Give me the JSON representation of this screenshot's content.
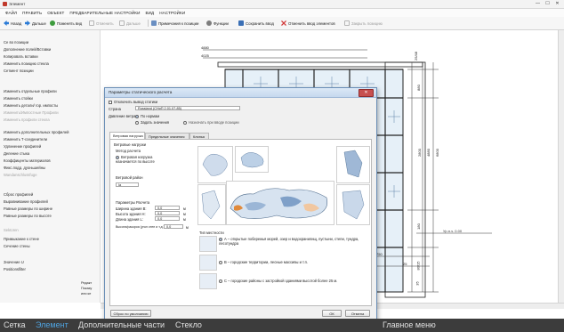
{
  "window": {
    "title": "Элемент",
    "min": "—",
    "max": "☐",
    "close": "✕"
  },
  "menu": [
    "ФАЙЛ",
    "ПРАВИТЬ",
    "ОБЪЕКТ",
    "ПРЕДВАРИТЕЛЬНЫЕ НАСТРОЙКИ",
    "ВИД",
    "НАСТРОЙКИ"
  ],
  "toolbar": {
    "back": "Назад",
    "forward": "Дальше",
    "change_view": "Поменять вид",
    "undo": "Отменить",
    "redo": "Дальше",
    "position_notes": "Примечания к позиции",
    "functions": "Функции",
    "save_input": "Сохранить ввод",
    "cancel_input": "Отменить ввод элементов",
    "close_position": "Закрыть позицию"
  },
  "left_panel": {
    "items": [
      {
        "label": "Се во позиции",
        "disabled": false
      },
      {
        "label": "Дополнение полей/Вставки",
        "disabled": false
      },
      {
        "label": "Копировать вставки",
        "disabled": false
      },
      {
        "label": "Изменить позицию стекла",
        "disabled": false
      },
      {
        "label": "Сетмент позиции",
        "disabled": false
      },
      {
        "label": "Изменить отдельные профили",
        "disabled": false
      },
      {
        "label": "Изменить стойки",
        "disabled": false
      },
      {
        "label": "Изменить детали/ гор. импосты",
        "disabled": false
      },
      {
        "label": "Изменить/Импостные Профили",
        "disabled": true
      },
      {
        "label": "Изменить профили стекла",
        "disabled": true
      },
      {
        "label": "Изменить дополнительных профилей",
        "disabled": false
      },
      {
        "label": "Изменить Т-соединители",
        "disabled": false
      },
      {
        "label": "Удлинение профилей",
        "disabled": false
      },
      {
        "label": "Деление стыка",
        "disabled": false
      },
      {
        "label": "Коэффиценты материалов",
        "disabled": false
      },
      {
        "label": "Фикс.подд. дуоньшейны",
        "disabled": false
      },
      {
        "label": "Wandanschlussfuge",
        "disabled": true
      },
      {
        "label": "Сброс профилей",
        "disabled": false
      },
      {
        "label": "Выравнивание профилей",
        "disabled": false
      },
      {
        "label": "Равные размеры по ширине",
        "disabled": false
      },
      {
        "label": "Равные размеры по высоте",
        "disabled": false
      },
      {
        "label": "Sektoren",
        "disabled": true
      },
      {
        "label": "Примыкание к стене",
        "disabled": false
      },
      {
        "label": "Сечение стены",
        "disabled": false
      },
      {
        "label": "Значение U",
        "disabled": false
      },
      {
        "label": "Positionsfilter",
        "disabled": false
      }
    ]
  },
  "drawing": {
    "dims_top": [
      "4880",
      "4025"
    ],
    "dims_right": [
      "25/48",
      "880",
      "2800",
      "4880",
      "6800",
      "180",
      "80/15",
      "35"
    ],
    "dims_bottom": [
      "750",
      "25"
    ],
    "level": "Ур.п.ч. 0.00",
    "left_note_lines": [
      "Редакт",
      "Показу",
      "или ке"
    ]
  },
  "dialog": {
    "title": "Параметры статического расчета",
    "disable_calc": "Отключить вывод статики",
    "country_label": "Страна",
    "country_value": "Russland (СНиП 2.01.07-85)",
    "wind_method_label": "Давление ветра",
    "radio_standard": "По нормам",
    "radio_manual": "Задать значения",
    "radio_on_input": "Назначать при вводе позиции",
    "tabs": [
      "Ветровая нагрузка",
      "Предельные значения",
      "Клинья"
    ],
    "section_title": "Ветровые нагрузки",
    "method_label": "Метод расчета",
    "method_option": "Ветровая нагрузка назначается по высоте",
    "wind_region_label": "Ветровой район",
    "wind_region_value": "Ia",
    "params_title": "Параметры Расчета",
    "param_width": {
      "label": "Ширина здания В:",
      "value": "0,0",
      "unit": "м"
    },
    "param_height": {
      "label": "Высота здания Н:",
      "value": "0,0",
      "unit": "м"
    },
    "param_length": {
      "label": "Длина здания L:",
      "value": "0,0",
      "unit": "м"
    },
    "param_edge": {
      "label": "Высота/раскроя (угол стен и т.д.)",
      "value": "0,0",
      "unit": "м"
    },
    "terrain_title": "Тип местности",
    "terrain_a": "А – открытые побережья морей, озер и водохранилищ, пустыни, степи, тундра, лесотундра",
    "terrain_b": "В – городские территории, лесные массивы и т.п.",
    "terrain_c": "С – городские районы с застройкой зданиями высотой более 25 м.",
    "defaults_btn": "Сброс по умолчанию",
    "ok_btn": "ОК",
    "cancel_btn": "Отмена"
  },
  "status_bar": {
    "items": [
      {
        "label": "Сетка",
        "active": false
      },
      {
        "label": "Элемент",
        "active": true
      },
      {
        "label": "Дополнительные части",
        "active": false
      },
      {
        "label": "Стекло",
        "active": false
      },
      {
        "label": "Главное меню",
        "active": false
      }
    ]
  },
  "colors": {
    "accent": "#2b6cc4",
    "active_tab": "#4fa3e0",
    "glass": "#c9def0",
    "frame": "#2c2c2c"
  }
}
